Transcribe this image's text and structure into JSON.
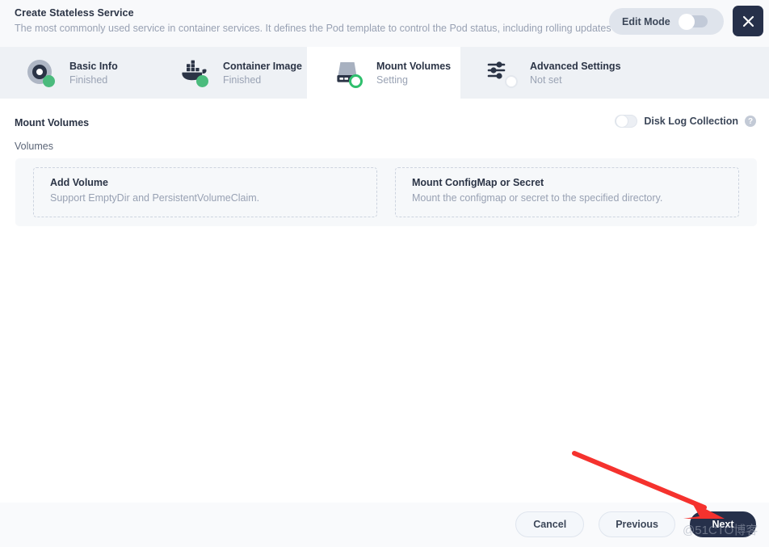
{
  "header": {
    "title": "Create Stateless Service",
    "description": "The most commonly used service in container services. It defines the Pod template to control the Pod status, including rolling updates and r",
    "edit_mode_label": "Edit Mode",
    "edit_mode_on": false,
    "close_icon": "close-icon"
  },
  "tabs": [
    {
      "name": "Basic Info",
      "status": "Finished",
      "icon": "disc-icon",
      "active": false,
      "state": "finished"
    },
    {
      "name": "Container Image",
      "status": "Finished",
      "icon": "docker-icon",
      "active": false,
      "state": "finished"
    },
    {
      "name": "Mount Volumes",
      "status": "Setting",
      "icon": "harddisk-icon",
      "active": true,
      "state": "setting"
    },
    {
      "name": "Advanced Settings",
      "status": "Not set",
      "icon": "sliders-icon",
      "active": false,
      "state": "notset"
    }
  ],
  "main": {
    "section_title": "Mount Volumes",
    "volumes_label": "Volumes",
    "disk_log": {
      "label": "Disk Log Collection",
      "enabled": false,
      "help_icon": "question-mark-icon",
      "help_glyph": "?"
    },
    "cards": [
      {
        "title": "Add Volume",
        "desc": "Support EmptyDir and PersistentVolumeClaim."
      },
      {
        "title": "Mount ConfigMap or Secret",
        "desc": "Mount the configmap or secret to the specified directory."
      }
    ]
  },
  "footer": {
    "cancel_label": "Cancel",
    "previous_label": "Previous",
    "next_label": "Next"
  },
  "annotations": {
    "arrow_color": "#f5322e",
    "watermark": "@51CTO博客"
  },
  "colors": {
    "accent_dark": "#26304a",
    "status_green": "#4bbb7d",
    "header_bg": "#f8f9fb",
    "tabbar_bg": "#eef1f5"
  }
}
